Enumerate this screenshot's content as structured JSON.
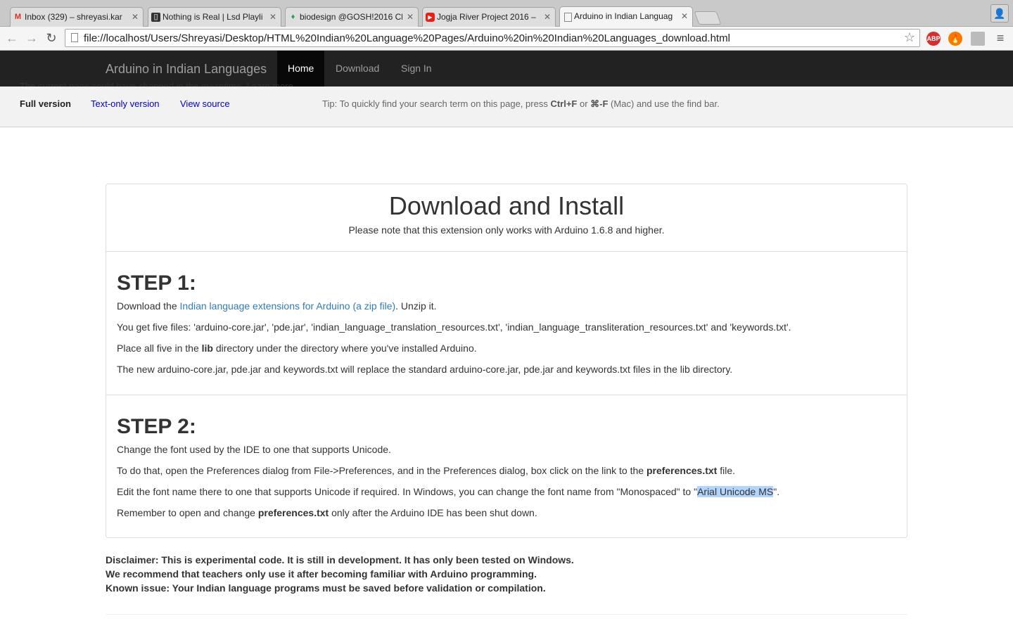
{
  "browser": {
    "tabs": [
      {
        "title": "Inbox (329) – shreyasi.kar",
        "icon": "gmail-icon",
        "icon_color": "#d93025"
      },
      {
        "title": "Nothing is Real | Lsd Playli",
        "icon": "app-icon",
        "icon_color": "#333333"
      },
      {
        "title": "biodesign @GOSH!2016 Cl",
        "icon": "leaf-icon",
        "icon_color": "#2e9e4f"
      },
      {
        "title": "Jogja River Project 2016 – ",
        "icon": "youtube-icon",
        "icon_color": "#e62117"
      },
      {
        "title": "Arduino in Indian Languag",
        "icon": "page-icon",
        "icon_color": "#888888"
      }
    ],
    "url": "file://localhost/Users/Shreyasi/Desktop/HTML%20Indian%20Language%20Pages/Arduino%20in%20Indian%20Languages_download.html",
    "extensions": {
      "abp": "ABP"
    }
  },
  "site": {
    "brand": "Arduino in Indian Languages",
    "nav": [
      "Home",
      "Download",
      "Sign In"
    ]
  },
  "archive": {
    "clipped_text": "The current page could have changed in the meantime. Learn more",
    "clipped_link1": "current page",
    "clipped_link2": "Learn more",
    "full_version": "Full version",
    "text_only": "Text-only version",
    "view_source": "View source",
    "tip_prefix": "Tip: To quickly find your search term on this page, press ",
    "tip_key1": "Ctrl+F",
    "tip_or": " or ",
    "tip_key2": "⌘-F",
    "tip_suffix": " (Mac) and use the find bar."
  },
  "content": {
    "title": "Download and Install",
    "note": "Please note that this extension only works with Arduino 1.6.8 and higher.",
    "step1": {
      "heading": "STEP 1:",
      "p1_prefix": "Download the ",
      "p1_link": "Indian language extensions for Arduino (a zip file)",
      "p1_suffix": ". Unzip it.",
      "p2": "You get five files: 'arduino-core.jar', 'pde.jar', 'indian_language_translation_resources.txt', 'indian_language_transliteration_resources.txt' and 'keywords.txt'.",
      "p3_prefix": "Place all five in the ",
      "p3_bold": "lib",
      "p3_suffix": " directory under the directory where you've installed Arduino.",
      "p4": "The new arduino-core.jar, pde.jar and keywords.txt will replace the standard arduino-core.jar, pde.jar and keywords.txt files in the lib directory."
    },
    "step2": {
      "heading": "STEP 2:",
      "p1": "Change the font used by the IDE to one that supports Unicode.",
      "p2_prefix": "To do that, open the Preferences dialog from File->Preferences, and in the Preferences dialog, box click on the link to the ",
      "p2_bold": "preferences.txt",
      "p2_suffix": " file.",
      "p3_prefix": "Edit the font name there to one that supports Unicode if required. In Windows, you can change the font name from \"Monospaced\" to \"",
      "p3_highlight": "Arial Unicode MS",
      "p3_suffix": "\".",
      "p4_prefix": "Remember to open and change ",
      "p4_bold": "preferences.txt",
      "p4_suffix": " only after the Arduino IDE has been shut down."
    },
    "disclaimer": [
      "Disclaimer: This is experimental code. It is still in development. It has only been tested on Windows.",
      "We recommend that teachers only use it after becoming familiar with Arduino programming.",
      "Known issue: Your Indian language programs must be saved before validation or compilation."
    ]
  }
}
